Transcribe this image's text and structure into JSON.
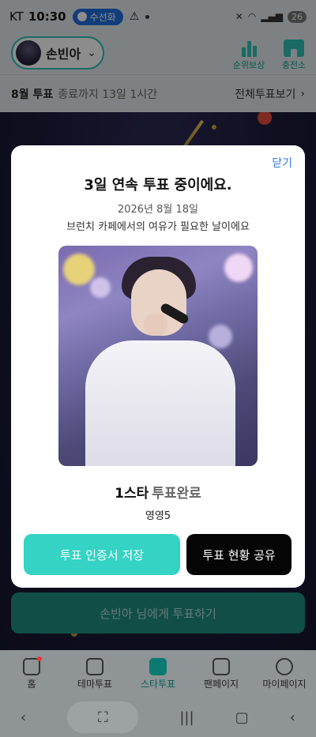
{
  "status_bar": {
    "carrier": "KT",
    "time": "10:30",
    "call_label": "수선화",
    "battery": "26"
  },
  "header": {
    "profile_name": "손빈아",
    "rank_reward_label": "순위보상",
    "charge_label": "충전소"
  },
  "month_bar": {
    "month_vote": "8월 투표",
    "remaining": "종료까지 13일 1시간",
    "all_votes_label": "전체투표보기"
  },
  "vote_button_label": "손빈아 님에게 투표하기",
  "modal": {
    "close_label": "닫기",
    "title": "3일 연속 투표 중이에요.",
    "date": "2026년 8월 18일",
    "message": "브런치 카페에서의 여유가 필요한 날이에요",
    "star_count": "1스타",
    "vote_status": "투표완료",
    "nickname": "영영5",
    "save_label": "투표 인증서 저장",
    "share_label": "투표 현황 공유"
  },
  "bottom_nav": [
    {
      "label": "홈",
      "icon": "home-icon"
    },
    {
      "label": "테마투표",
      "icon": "theme-vote-icon"
    },
    {
      "label": "스타투표",
      "icon": "star-vote-icon"
    },
    {
      "label": "팬페이지",
      "icon": "fanpage-icon"
    },
    {
      "label": "마이페이지",
      "icon": "mypage-icon"
    }
  ],
  "colors": {
    "accent": "#34d3c3",
    "link": "#2f7ae5",
    "dark_button": "#050505"
  }
}
